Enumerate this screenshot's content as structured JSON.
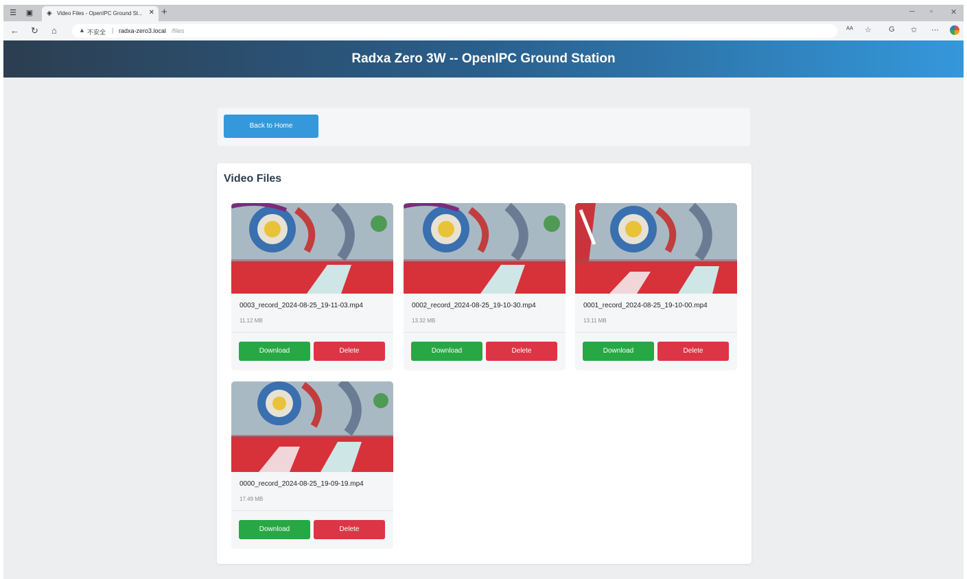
{
  "browser": {
    "tab_title": "Video Files - OpenIPC Ground St...",
    "url_security": "不安全",
    "url_host": "radxa-zero3.local",
    "url_path": "/files"
  },
  "header": {
    "title": "Radxa Zero 3W -- OpenIPC Ground Station"
  },
  "nav": {
    "back_label": "Back to Home"
  },
  "files": {
    "heading": "Video Files",
    "download_label": "Download",
    "delete_label": "Delete",
    "items": [
      {
        "name": "0003_record_2024-08-25_19-11-03.mp4",
        "size": "11.12 MB"
      },
      {
        "name": "0002_record_2024-08-25_19-10-30.mp4",
        "size": "13.32 MB"
      },
      {
        "name": "0001_record_2024-08-25_19-10-00.mp4",
        "size": "13.11 MB"
      },
      {
        "name": "0000_record_2024-08-25_19-09-19.mp4",
        "size": "17.49 MB"
      }
    ]
  },
  "colors": {
    "header_start": "#2c3e50",
    "header_end": "#3498db",
    "primary": "#3498db",
    "download": "#28a745",
    "delete": "#dc3545"
  }
}
